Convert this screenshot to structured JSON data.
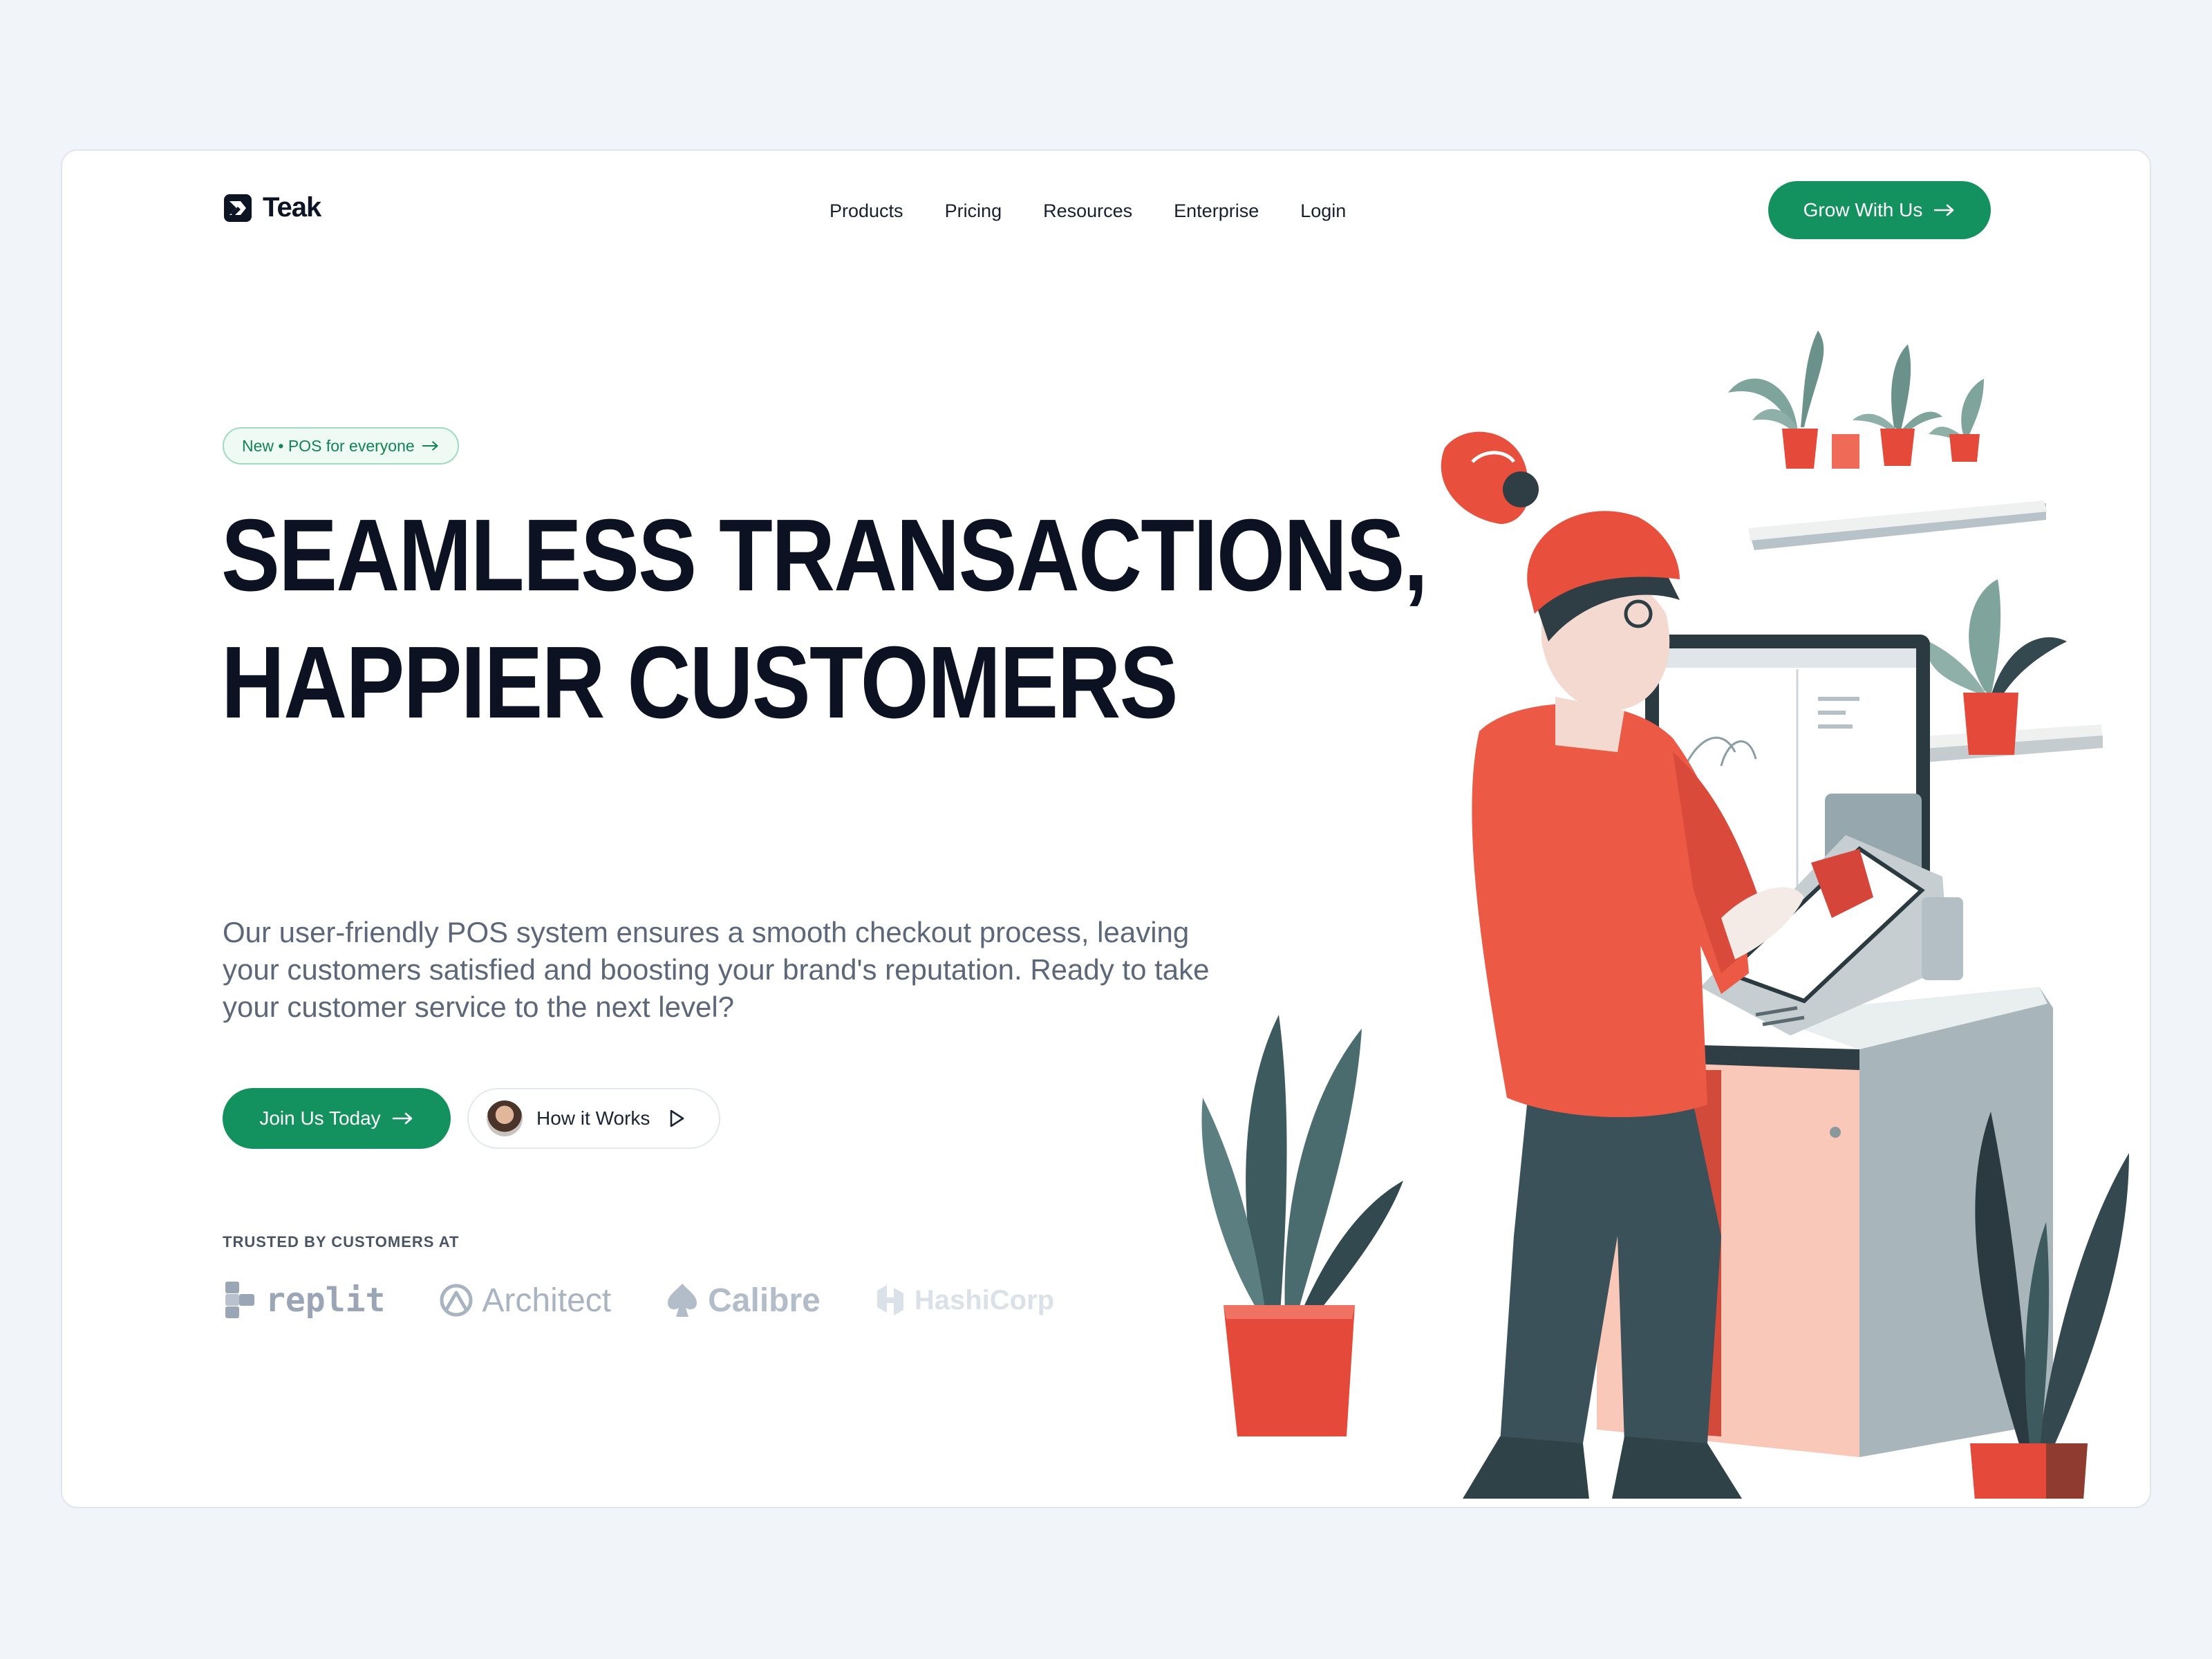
{
  "brand": {
    "name": "Teak"
  },
  "nav": {
    "items": [
      {
        "label": "Products"
      },
      {
        "label": "Pricing"
      },
      {
        "label": "Resources"
      },
      {
        "label": "Enterprise"
      },
      {
        "label": "Login"
      }
    ],
    "cta_label": "Grow With Us"
  },
  "hero": {
    "badge": "New • POS for everyone",
    "headline_line1": "SEAMLESS TRANSACTIONS,",
    "headline_line2": "HAPPIER CUSTOMERS",
    "subtitle": "Our user-friendly POS system ensures a smooth checkout process, leaving your customers satisfied and boosting your brand's reputation. Ready to take your customer service to the next level?",
    "primary_button": "Join Us Today",
    "secondary_button": "How it Works"
  },
  "trusted": {
    "label": "TRUSTED BY CUSTOMERS AT",
    "companies": [
      "replit",
      "Architect",
      "Calibre",
      "HashiCorp"
    ]
  },
  "colors": {
    "accent": "#13915e",
    "headline": "#0c1222",
    "background": "#f1f4f8"
  }
}
